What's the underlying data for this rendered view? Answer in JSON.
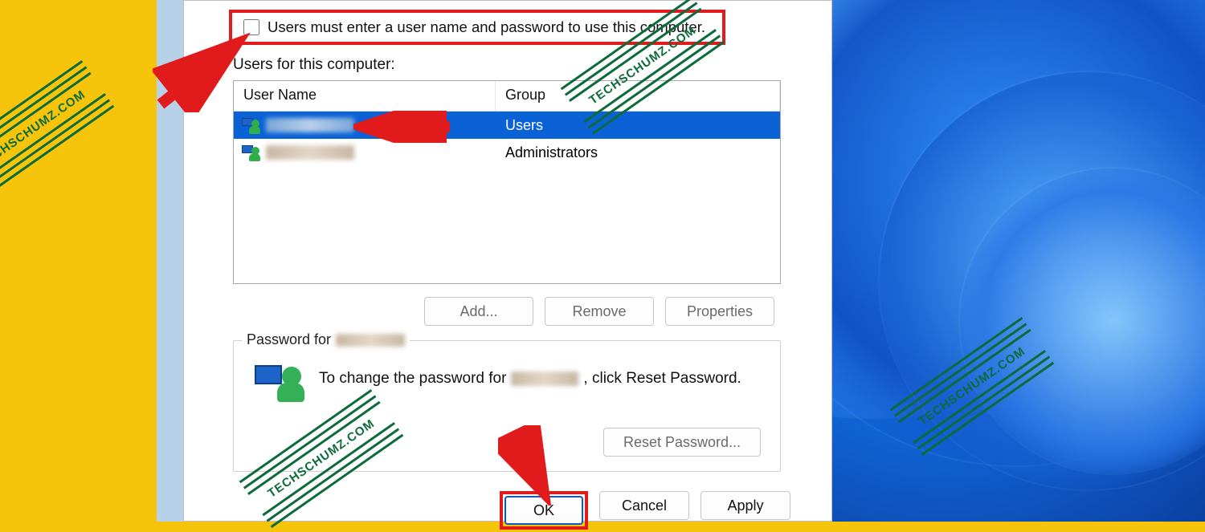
{
  "checkbox": {
    "label": "Users must enter a user name and password to use this computer.",
    "checked": false
  },
  "users_section_label": "Users for this computer:",
  "columns": {
    "name": "User Name",
    "group": "Group"
  },
  "rows": [
    {
      "group": "Users",
      "selected": true
    },
    {
      "group": "Administrators",
      "selected": false
    }
  ],
  "list_buttons": {
    "add": "Add...",
    "remove": "Remove",
    "properties": "Properties"
  },
  "password_group": {
    "legend_prefix": "Password for",
    "msg_a": "To change the password for",
    "msg_b": ", click Reset Password.",
    "reset": "Reset Password..."
  },
  "dialog_buttons": {
    "ok": "OK",
    "cancel": "Cancel",
    "apply": "Apply"
  },
  "watermark_text": "TECHSCHUMZ.COM"
}
